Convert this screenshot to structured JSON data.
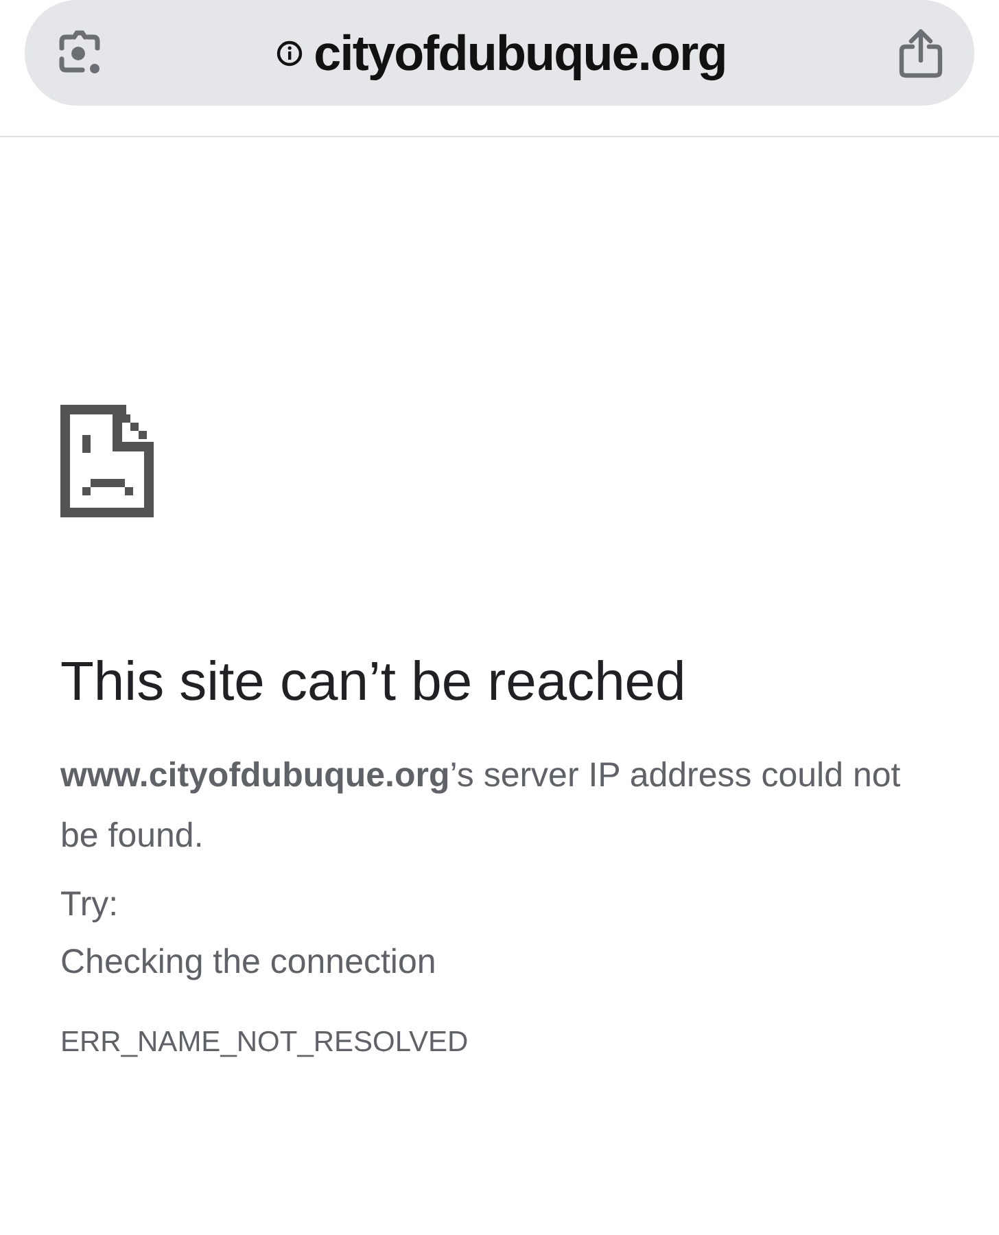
{
  "address_bar": {
    "url": "cityofdubuque.org"
  },
  "error": {
    "title": "This site can’t be reached",
    "message": "**www.cityofdubuque.org**’s server IP address could not be found.",
    "try_label": "Try:",
    "suggestions": [
      "Checking the connection"
    ],
    "code": "ERR_NAME_NOT_RESOLVED"
  }
}
